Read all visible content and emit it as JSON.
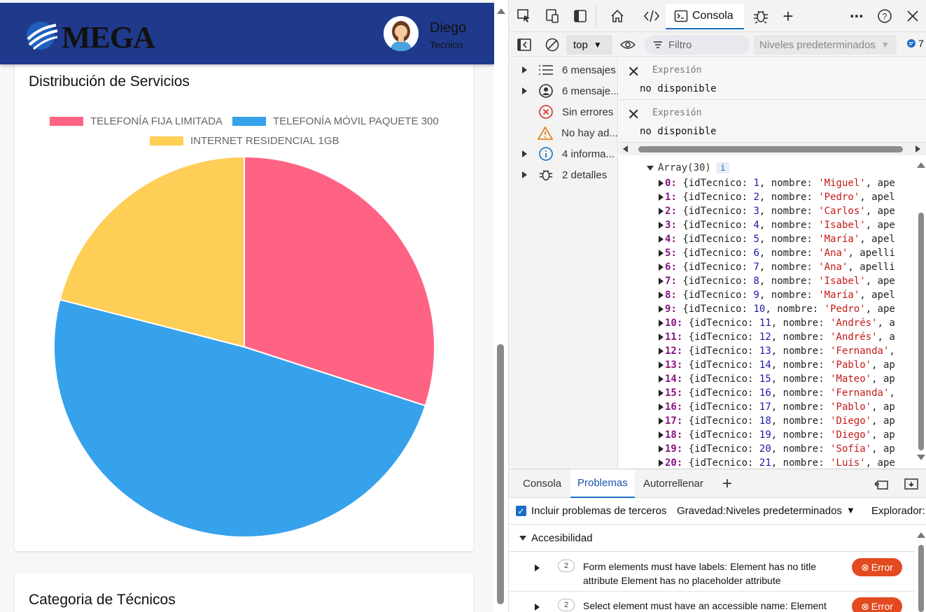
{
  "header": {
    "logo_text": "MEGA",
    "user_name": "Diego",
    "user_role": "Tecnico"
  },
  "services_card": {
    "title": "Distribución de Servicios"
  },
  "techs_card": {
    "title": "Categoria de Técnicos"
  },
  "chart_data": {
    "type": "pie",
    "categories": [
      "TELEFONÍA FIJA LIMITADA",
      "TELEFONÍA MÓVIL PAQUETE 300",
      "INTERNET RESIDENCIAL 1GB"
    ],
    "values": [
      30,
      49,
      21
    ],
    "colors": [
      "#ff6384",
      "#36a2eb",
      "#ffce56"
    ],
    "legend": "top"
  },
  "devtools": {
    "tabs": {
      "console": "Consola"
    },
    "toolbar": {
      "context": "top",
      "filter_placeholder": "Filtro",
      "levels": "Niveles predeterminados",
      "message_count": "7"
    },
    "sidebar": [
      {
        "label": "6 mensajes",
        "icon": "list-icon",
        "expandable": true
      },
      {
        "label": "6 mensaje...",
        "icon": "user-circle-icon",
        "expandable": true
      },
      {
        "label": "Sin errores",
        "icon": "error-circle-icon",
        "expandable": false
      },
      {
        "label": "No hay ad...",
        "icon": "warning-icon",
        "expandable": false
      },
      {
        "label": "4 informa...",
        "icon": "info-icon",
        "expandable": true
      },
      {
        "label": "2 detalles",
        "icon": "bug-icon",
        "expandable": true
      }
    ],
    "expressions": [
      {
        "label": "Expresión",
        "value": "no disponible"
      },
      {
        "label": "Expresión",
        "value": "no disponible"
      }
    ],
    "console": {
      "array_label": "Array(30)",
      "array_badge": "i",
      "rows": [
        {
          "index": "0",
          "id": "1",
          "nombre": "'Miguel'",
          "tail": "ape"
        },
        {
          "index": "1",
          "id": "2",
          "nombre": "'Pedro'",
          "tail": "apel"
        },
        {
          "index": "2",
          "id": "3",
          "nombre": "'Carlos'",
          "tail": "ape"
        },
        {
          "index": "3",
          "id": "4",
          "nombre": "'Isabel'",
          "tail": "ape"
        },
        {
          "index": "4",
          "id": "5",
          "nombre": "'María'",
          "tail": "apel"
        },
        {
          "index": "5",
          "id": "6",
          "nombre": "'Ana'",
          "tail": "apelli"
        },
        {
          "index": "6",
          "id": "7",
          "nombre": "'Ana'",
          "tail": "apelli"
        },
        {
          "index": "7",
          "id": "8",
          "nombre": "'Isabel'",
          "tail": "ape"
        },
        {
          "index": "8",
          "id": "9",
          "nombre": "'María'",
          "tail": "apel"
        },
        {
          "index": "9",
          "id": "10",
          "nombre": "'Pedro'",
          "tail": "ape"
        },
        {
          "index": "10",
          "id": "11",
          "nombre": "'Andrés'",
          "tail": "a"
        },
        {
          "index": "11",
          "id": "12",
          "nombre": "'Andrés'",
          "tail": "a"
        },
        {
          "index": "12",
          "id": "13",
          "nombre": "'Fernanda'",
          "tail": ""
        },
        {
          "index": "13",
          "id": "14",
          "nombre": "'Pablo'",
          "tail": "ap"
        },
        {
          "index": "14",
          "id": "15",
          "nombre": "'Mateo'",
          "tail": "ap"
        },
        {
          "index": "15",
          "id": "16",
          "nombre": "'Fernanda'",
          "tail": ""
        },
        {
          "index": "16",
          "id": "17",
          "nombre": "'Pablo'",
          "tail": "ap"
        },
        {
          "index": "17",
          "id": "18",
          "nombre": "'Diego'",
          "tail": "ap"
        },
        {
          "index": "18",
          "id": "19",
          "nombre": "'Diego'",
          "tail": "ap"
        },
        {
          "index": "19",
          "id": "20",
          "nombre": "'Sofía'",
          "tail": "ap"
        },
        {
          "index": "20",
          "id": "21",
          "nombre": "'Luis'",
          "tail": "ape"
        }
      ]
    },
    "drawer": {
      "tabs": [
        "Consola",
        "Problemas",
        "Autorrellenar"
      ],
      "third_party_label": "Incluir problemas de terceros",
      "severity_label": "Gravedad:",
      "severity_value": "Niveles predeterminados",
      "explorer_label": "Explorador:",
      "section": "Accesibilidad",
      "issues": [
        {
          "count": "2",
          "text": "Form elements must have labels: Element has no title attribute Element has no placeholder attribute",
          "badge": "Error"
        },
        {
          "count": "2",
          "text": "Select element must have an accessible name: Element",
          "badge": "Error"
        }
      ]
    }
  }
}
